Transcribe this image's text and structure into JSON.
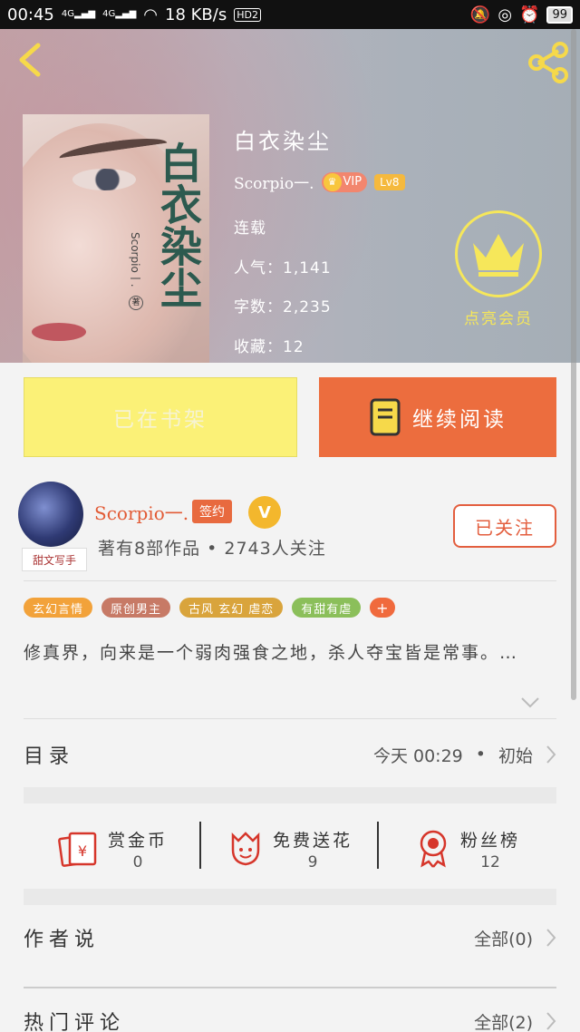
{
  "status_bar": {
    "time": "00:45",
    "signal1": "4G",
    "signal2": "4G",
    "net_speed": "18 KB/s",
    "hd": "HD2",
    "battery": "99"
  },
  "book": {
    "title": "白衣染尘",
    "author": "Scorpio一.",
    "vip_label": "VIP",
    "level_label": "Lv8",
    "status": "连载",
    "popularity": "人气：1,141",
    "word_count": "字数：2,235",
    "favorites": "收藏：12",
    "cover_title": "白衣染尘",
    "cover_author": "Scorpio一.",
    "cover_seal": "著"
  },
  "vip_promo": {
    "label": "点亮会员"
  },
  "actions": {
    "shelf_label": "已在书架",
    "read_label": "继续阅读"
  },
  "author_card": {
    "name": "Scorpio一.",
    "sign_badge": "签约",
    "v_badge": "V",
    "avatar_tag": "甜文写手",
    "works_line": "著有8部作品 • 2743人关注",
    "follow_label": "已关注"
  },
  "tags": [
    {
      "label": "玄幻言情",
      "color": "#f2a23a"
    },
    {
      "label": "原创男主",
      "color": "#c77a66"
    },
    {
      "label": "古风 玄幻 虐恋",
      "color": "#d9a43c"
    },
    {
      "label": "有甜有虐",
      "color": "#8bbf5a"
    },
    {
      "label": "+",
      "color": "#f06a3d"
    }
  ],
  "synopsis": "修真界，向来是一个弱肉强食之地，杀人夺宝皆是常事。…",
  "directory": {
    "title": "目录",
    "update_time": "今天 00:29",
    "dot": "•",
    "latest_chapter": "初始"
  },
  "stats": [
    {
      "label": "赏金币",
      "value": "0",
      "icon": "red-envelope-icon"
    },
    {
      "label": "免费送花",
      "value": "9",
      "icon": "flower-icon"
    },
    {
      "label": "粉丝榜",
      "value": "12",
      "icon": "award-ribbon-icon"
    }
  ],
  "author_says": {
    "title": "作者说",
    "link": "全部(0)"
  },
  "hot_comments": {
    "title": "热门评论",
    "link": "全部(2)"
  }
}
